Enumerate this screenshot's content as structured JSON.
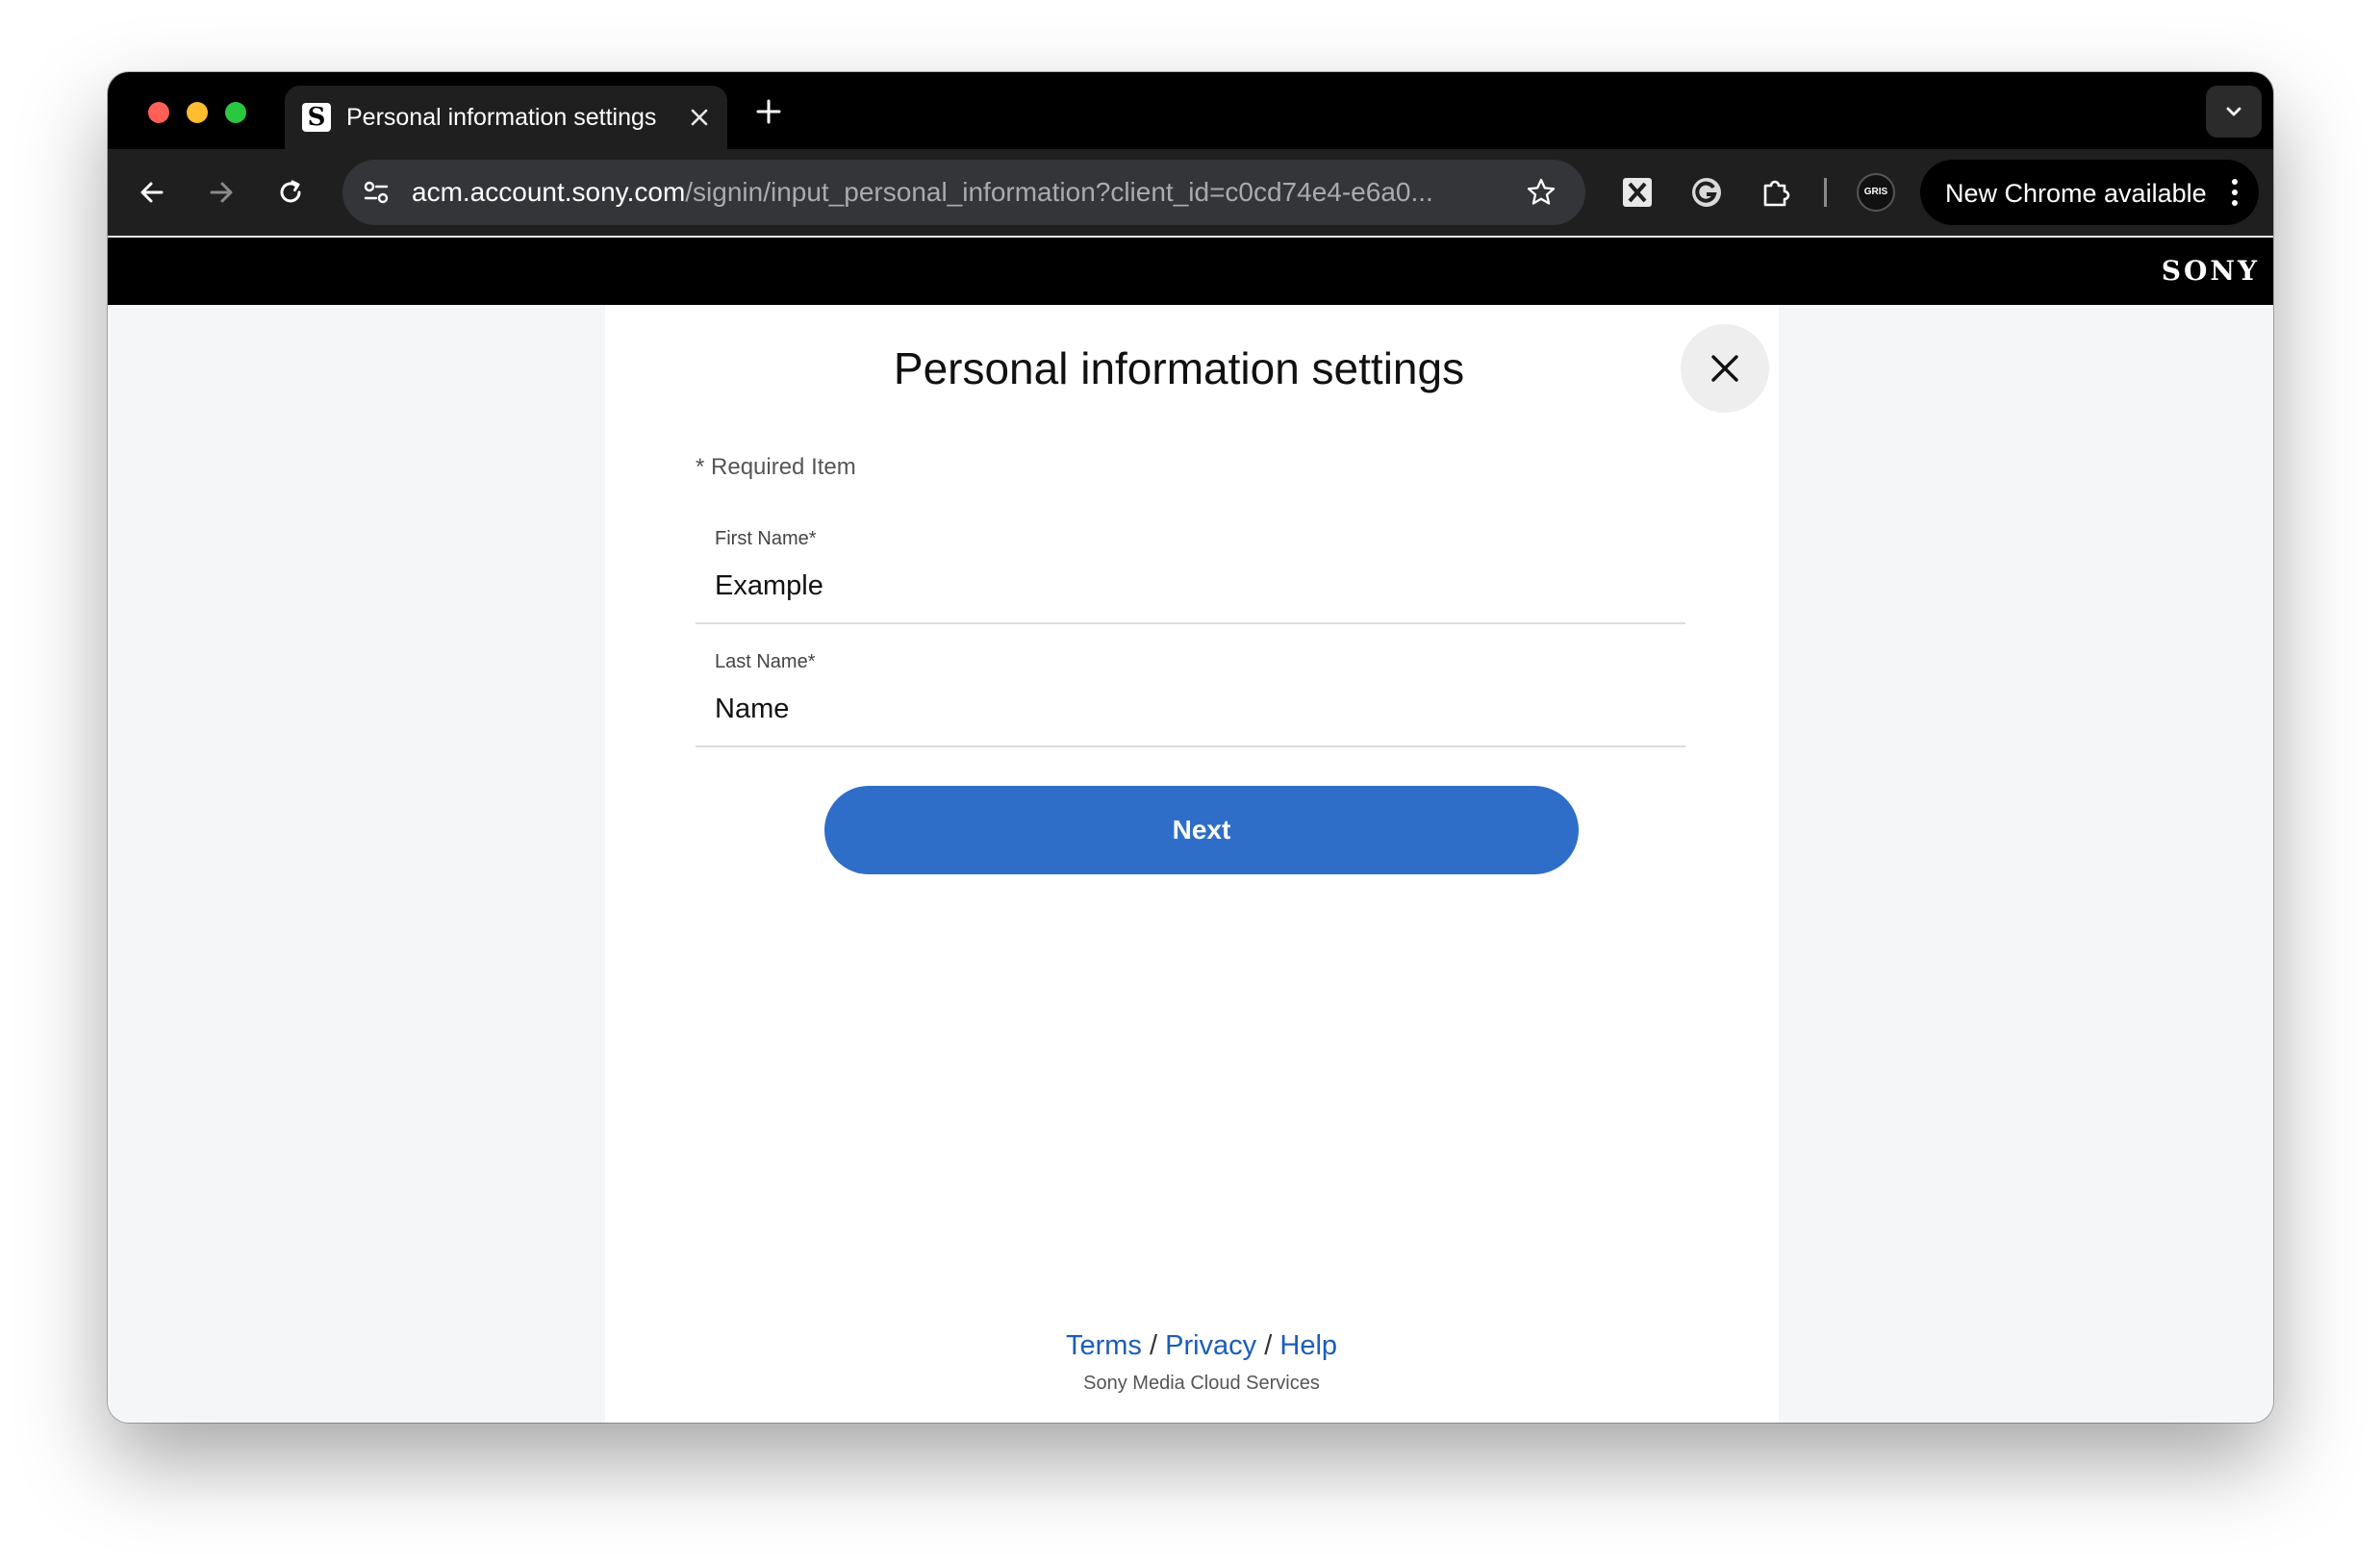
{
  "browser": {
    "tab": {
      "title": "Personal information settings",
      "favicon_letter": "S"
    },
    "url": {
      "host": "acm.account.sony.com",
      "path": "/signin/input_personal_information?client_id=c0cd74e4-e6a0..."
    },
    "update_label": "New Chrome available",
    "profile_badge": "GRIS",
    "icons": [
      "back-icon",
      "forward-icon",
      "reload-icon",
      "tune-icon",
      "star-icon",
      "x-extension-icon",
      "google-extension-icon",
      "puzzle-icon",
      "kebab-menu-icon",
      "close-icon",
      "plus-icon",
      "chevron-down-icon"
    ]
  },
  "site_header": {
    "logo": "SONY"
  },
  "form": {
    "title": "Personal information settings",
    "required_note": "* Required Item",
    "fields": [
      {
        "label": "First Name*",
        "value": "Example"
      },
      {
        "label": "Last Name*",
        "value": "Name"
      }
    ],
    "submit_label": "Next"
  },
  "footer": {
    "links": [
      "Terms",
      "Privacy",
      "Help"
    ],
    "separator": "/",
    "service_name": "Sony Media Cloud Services"
  },
  "colors": {
    "primary_button": "#2e6ec8",
    "link": "#1a5eb8",
    "chrome_dark": "#1f1f1f",
    "page_bg": "#f5f6f8"
  }
}
